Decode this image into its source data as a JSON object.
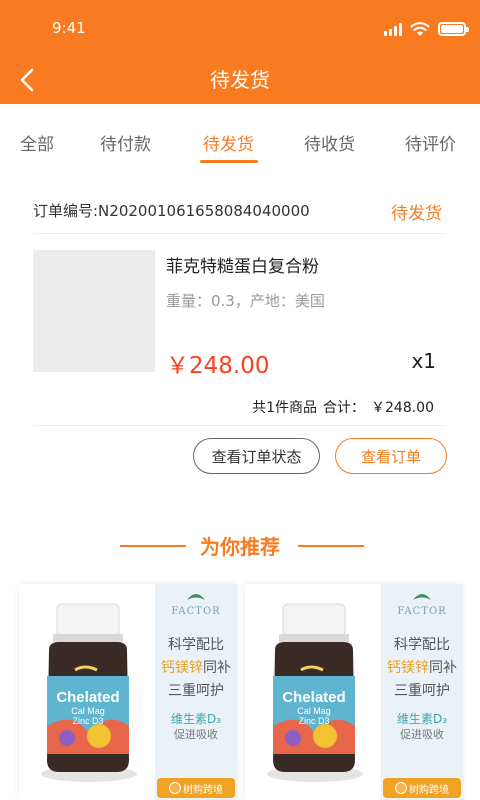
{
  "status_bar": {
    "time": "9:41"
  },
  "header": {
    "title": "待发货",
    "back_icon": "back-arrow-icon"
  },
  "tabs": [
    {
      "label": "全部",
      "active": false
    },
    {
      "label": "待付款",
      "active": false
    },
    {
      "label": "待发货",
      "active": true
    },
    {
      "label": "待收货",
      "active": false
    },
    {
      "label": "待评价",
      "active": false
    }
  ],
  "order": {
    "number_text": "订单编号:N202001061658084040000",
    "status": "待发货",
    "product": {
      "name": "菲克特糙蛋白复合粉",
      "spec": "重量：0.3，产地：美国",
      "price": "￥248.00",
      "qty": "x1"
    },
    "summary": {
      "count_text": "共1件商品",
      "total_label": "合计：",
      "total_value": "￥248.00"
    },
    "buttons": {
      "status": "查看订单状态",
      "view": "查看订单"
    }
  },
  "recommend": {
    "title": "为你推荐",
    "cards": [
      {
        "bottle_label": [
          "Chelated",
          "Cal Mag",
          "Zinc D3"
        ],
        "brand": "FACTOR",
        "line1": "科学配比",
        "line2_highlight": "钙镁锌",
        "line2_rest": "同补",
        "line3": "三重呵护",
        "line4": "维生素D₃",
        "line5": "促进吸收",
        "badge": "树购跨境"
      },
      {
        "bottle_label": [
          "Chelated",
          "Cal Mag",
          "Zinc D3"
        ],
        "brand": "FACTOR",
        "line1": "科学配比",
        "line2_highlight": "钙镁锌",
        "line2_rest": "同补",
        "line3": "三重呵护",
        "line4": "维生素D₃",
        "line5": "促进吸收",
        "badge": "树购跨境"
      }
    ]
  },
  "colors": {
    "accent": "#f87b21",
    "price": "#f8421d"
  }
}
